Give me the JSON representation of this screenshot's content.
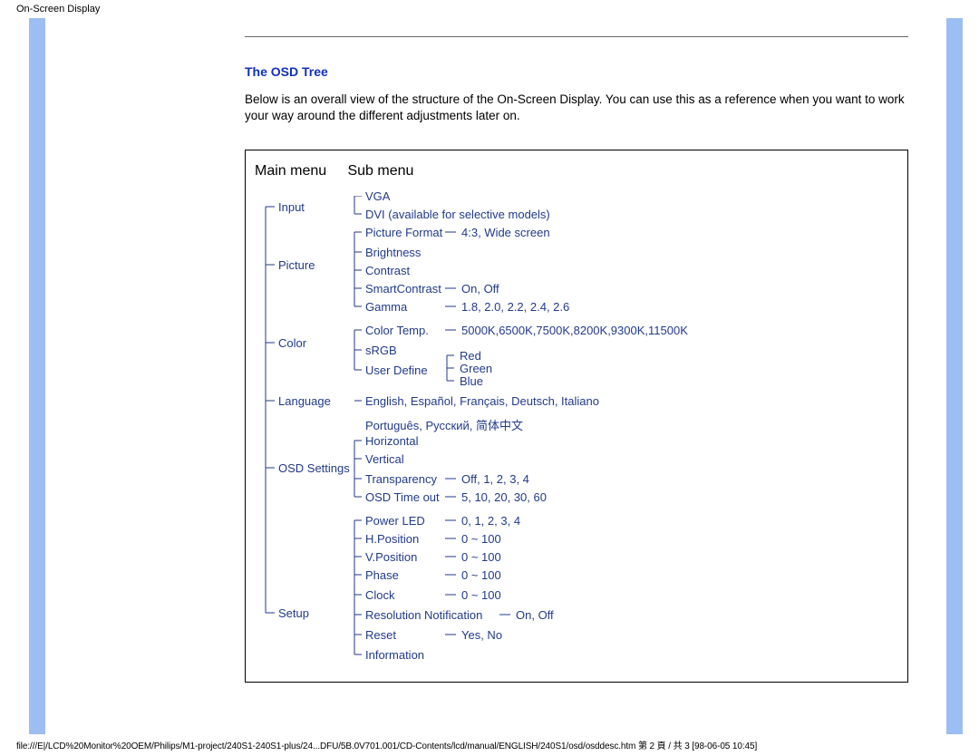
{
  "top": "On-Screen Display",
  "heading": "The OSD Tree",
  "intro": "Below is an overall view of the structure of the On-Screen Display. You can use this as a reference when you want to work your way around the different adjustments later on.",
  "col_main": "Main menu",
  "col_sub": "Sub menu",
  "main": {
    "input": "Input",
    "picture": "Picture",
    "color": "Color",
    "language": "Language",
    "osd": "OSD Settings",
    "setup": "Setup"
  },
  "sub": {
    "vga": "VGA",
    "dvi": "DVI (available for selective models)",
    "picfmt": "Picture Format",
    "picfmt_v": "4:3, Wide screen",
    "bright": "Brightness",
    "contrast": "Contrast",
    "smart": "SmartContrast",
    "smart_v": "On, Off",
    "gamma": "Gamma",
    "gamma_v": "1.8, 2.0, 2.2, 2.4, 2.6",
    "coltemp": "Color Temp.",
    "coltemp_v": "5000K,6500K,7500K,8200K,9300K,11500K",
    "srgb": "sRGB",
    "userdef": "User Define",
    "red": "Red",
    "green": "Green",
    "blue": "Blue",
    "lang_v": "English, Español, Français, Deutsch, Italiano",
    "lang_v2": "Português, Русский, 简体中文",
    "horiz": "Horizontal",
    "vert": "Vertical",
    "transp": "Transparency",
    "transp_v": "Off, 1, 2, 3, 4",
    "osdtime": "OSD Time out",
    "osdtime_v": "5, 10, 20, 30, 60",
    "pled": "Power LED",
    "pled_v": "0, 1, 2, 3, 4",
    "hpos": "H.Position",
    "hpos_v": "0 ~ 100",
    "vpos": "V.Position",
    "vpos_v": "0 ~ 100",
    "phase": "Phase",
    "phase_v": "0 ~ 100",
    "clock": "Clock",
    "clock_v": "0 ~ 100",
    "resn": "Resolution Notification",
    "resn_v": "On, Off",
    "reset": "Reset",
    "reset_v": "Yes, No",
    "info": "Information"
  },
  "footer": "file:///E|/LCD%20Monitor%20OEM/Philips/M1-project/240S1-240S1-plus/24...DFU/5B.0V701.001/CD-Contents/lcd/manual/ENGLISH/240S1/osd/osddesc.htm 第 2 頁 / 共 3 [98-06-05 10:45]"
}
